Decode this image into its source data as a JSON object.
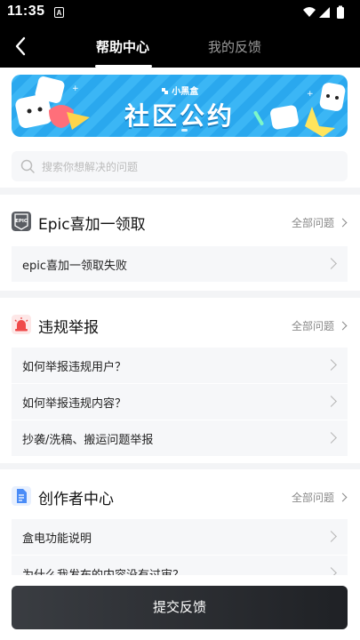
{
  "status_bar": {
    "time": "11:35",
    "sim_label": "A"
  },
  "nav": {
    "tabs": [
      {
        "label": "帮助中心"
      },
      {
        "label": "我的反馈"
      }
    ]
  },
  "banner": {
    "logo_text": "小黑盒",
    "title": "社区公约"
  },
  "search": {
    "placeholder": "搜索你想解决的问题"
  },
  "sections": [
    {
      "title": "Epic喜加一领取",
      "icon": "epic-logo-icon",
      "all_label": "全部问题",
      "items": [
        {
          "label": "epic喜加一领取失败"
        }
      ]
    },
    {
      "title": "违规举报",
      "icon": "alarm-siren-icon",
      "all_label": "全部问题",
      "items": [
        {
          "label": "如何举报违规用户？"
        },
        {
          "label": "如何举报违规内容？"
        },
        {
          "label": "抄袭/洗稿、搬运问题举报"
        }
      ]
    },
    {
      "title": "创作者中心",
      "icon": "document-icon",
      "all_label": "全部问题",
      "items": [
        {
          "label": "盒电功能说明"
        },
        {
          "label": "为什么我发布的内容没有过审？"
        }
      ]
    }
  ],
  "footer": {
    "submit_label": "提交反馈"
  },
  "colors": {
    "banner_blue": "#2aa8ee",
    "siren_red": "#f04a4a",
    "doc_blue": "#4a8cf7"
  }
}
